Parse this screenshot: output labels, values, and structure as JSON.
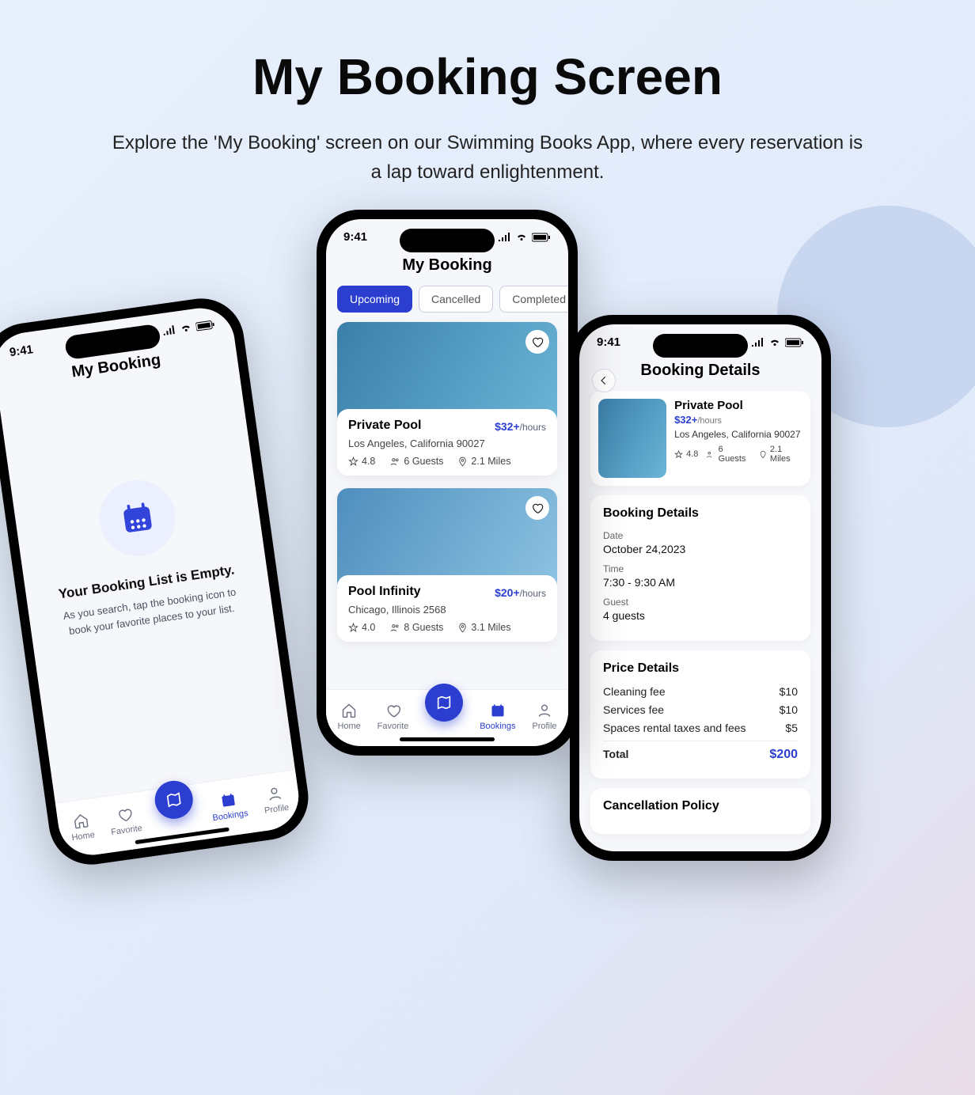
{
  "header": {
    "title": "My Booking Screen",
    "subtitle": "Explore the 'My Booking' screen on our Swimming Books App, where every reservation is a lap toward enlightenment."
  },
  "statusbar": {
    "time": "9:41"
  },
  "nav": {
    "home": "Home",
    "favorite": "Favorite",
    "bookings": "Bookings",
    "profile": "Profile"
  },
  "phone1": {
    "title": "My Booking",
    "empty_title": "Your Booking List is Empty.",
    "empty_sub": "As you search, tap the booking icon to book your favorite places to your list."
  },
  "phone2": {
    "title": "My Booking",
    "tabs": {
      "upcoming": "Upcoming",
      "cancelled": "Cancelled",
      "completed": "Completed"
    },
    "cards": [
      {
        "title": "Private Pool",
        "price": "$32+",
        "unit": "/hours",
        "location": "Los Angeles, California 90027",
        "rating": "4.8",
        "guests": "6 Guests",
        "distance": "2.1 Miles"
      },
      {
        "title": "Pool Infinity",
        "price": "$20+",
        "unit": "/hours",
        "location": "Chicago, Illinois 2568",
        "rating": "4.0",
        "guests": "8 Guests",
        "distance": "3.1 Miles"
      }
    ]
  },
  "phone3": {
    "title": "Booking Details",
    "summary": {
      "title": "Private Pool",
      "price": "$32+",
      "unit": "/hours",
      "location": "Los Angeles, California 90027",
      "rating": "4.8",
      "guests": "6 Guests",
      "distance": "2.1 Miles"
    },
    "booking_heading": "Booking Details",
    "booking": {
      "date_label": "Date",
      "date_value": "October 24,2023",
      "time_label": "Time",
      "time_value": "7:30 - 9:30 AM",
      "guest_label": "Guest",
      "guest_value": "4 guests"
    },
    "price_heading": "Price Details",
    "prices": {
      "cleaning_label": "Cleaning fee",
      "cleaning_value": "$10",
      "services_label": "Services fee",
      "services_value": "$10",
      "taxes_label": "Spaces rental taxes and fees",
      "taxes_value": "$5",
      "total_label": "Total",
      "total_value": "$200"
    },
    "cancel_heading": "Cancellation Policy"
  }
}
